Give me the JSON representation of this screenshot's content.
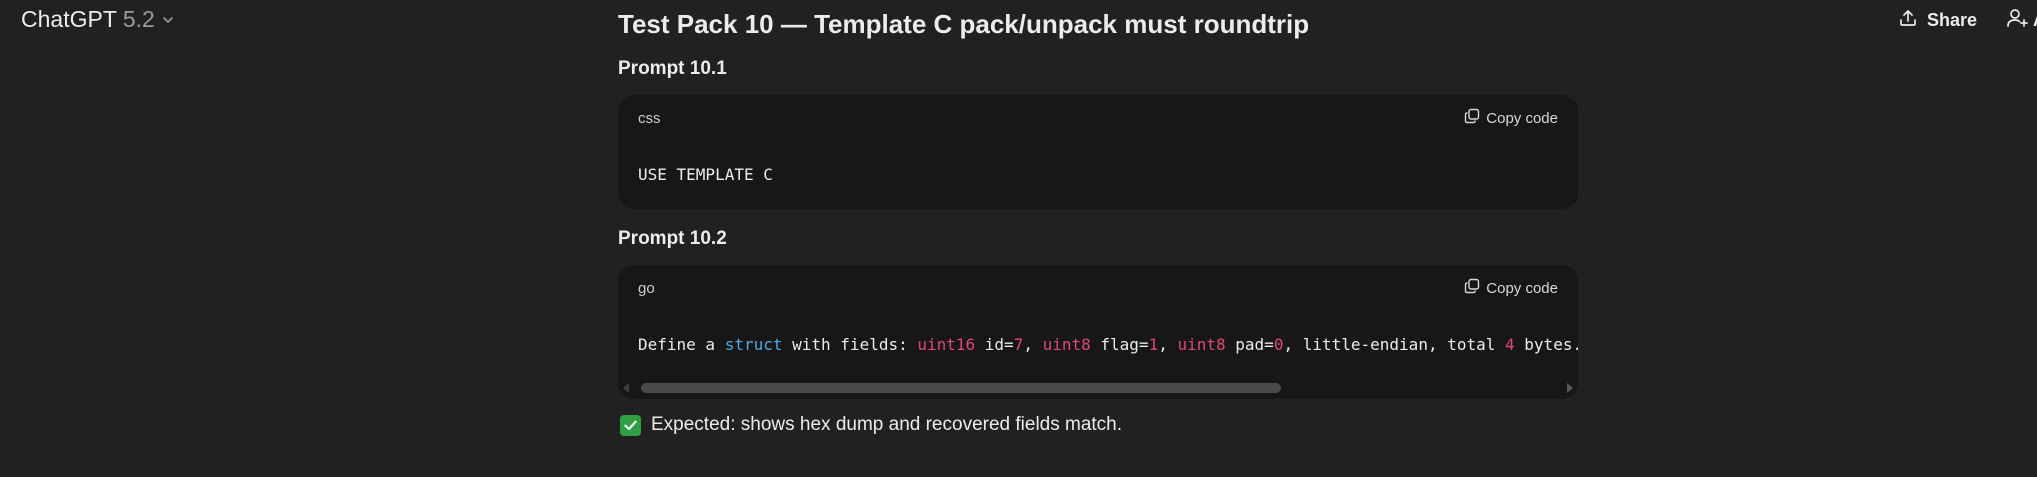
{
  "header": {
    "model_name": "ChatGPT",
    "model_version": "5.2",
    "share_label": "Share",
    "add_people_label": "A"
  },
  "conversation": {
    "heading": "Test Pack 10 — Template C pack/unpack must roundtrip",
    "prompts": [
      {
        "title": "Prompt 10.1",
        "language": "css",
        "copy_label": "Copy code",
        "code": "USE TEMPLATE C"
      },
      {
        "title": "Prompt 10.2",
        "language": "go",
        "copy_label": "Copy code",
        "code_tokens": {
          "t1": "Define a ",
          "t2": "struct",
          "t3": " with fields: ",
          "t4": "uint16",
          "t5": " id=",
          "t6": "7",
          "t7": ", ",
          "t8": "uint8",
          "t9": " flag=",
          "t10": "1",
          "t11": ", ",
          "t12": "uint8",
          "t13": " pad=",
          "t14": "0",
          "t15": ", little-endian, total ",
          "t16": "4",
          "t17": " bytes."
        }
      }
    ],
    "expected_icon": "check-mark-button-icon",
    "expected_text": "Expected: shows hex dump and recovered fields match."
  },
  "colors": {
    "background": "#212121",
    "code_background": "#171717",
    "keyword": "#4fa8e0",
    "type_and_number": "#e2457a",
    "check_green": "#2ea043"
  }
}
